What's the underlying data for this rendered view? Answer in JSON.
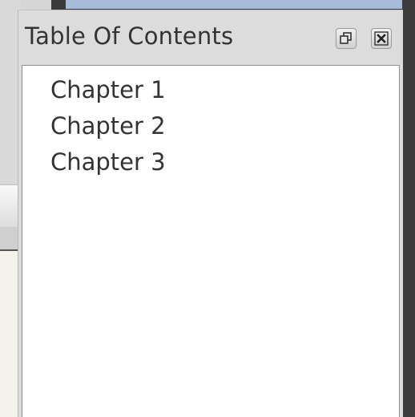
{
  "dock": {
    "title": "Table Of Contents",
    "buttons": {
      "float_icon": "float-restore-icon",
      "close_icon": "close-icon"
    }
  },
  "toc": {
    "items": [
      {
        "label": "Chapter 1"
      },
      {
        "label": "Chapter 2"
      },
      {
        "label": "Chapter 3"
      }
    ]
  }
}
